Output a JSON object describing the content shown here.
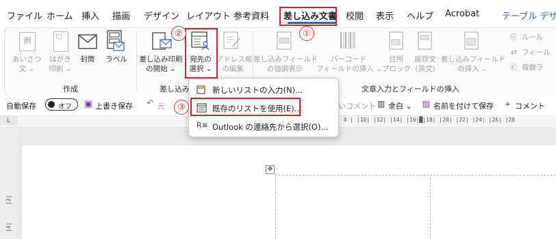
{
  "menu_tabs": [
    {
      "label": "ファイル"
    },
    {
      "label": "ホーム"
    },
    {
      "label": "挿入"
    },
    {
      "label": "描画"
    },
    {
      "label": "デザイン"
    },
    {
      "label": "レイアウト"
    },
    {
      "label": "参考資料"
    },
    {
      "label": "差し込み文書"
    },
    {
      "label": "校閲"
    },
    {
      "label": "表示"
    },
    {
      "label": "ヘルプ"
    },
    {
      "label": "Acrobat"
    },
    {
      "label": "テーブル デザ"
    }
  ],
  "ribbon": {
    "create_group": {
      "label": "作成",
      "greeting": {
        "line1": "あいさつ",
        "line2": "文 ⌄",
        "icon_char": "例"
      },
      "postcard": {
        "line1": "はがき",
        "line2": "印刷 ⌄"
      },
      "envelope": {
        "label": "封筒"
      },
      "label_btn": {
        "label": "ラベル"
      }
    },
    "mailmerge_group": {
      "label": "差し込み",
      "start": {
        "line1": "差し込み印刷",
        "line2": "の開始 ⌄"
      },
      "select_recipients": {
        "line1": "宛先の",
        "line2": "選択 ⌄"
      },
      "edit_list": {
        "line1": "アドレス帳",
        "line2": "の編集"
      }
    },
    "fields_group": {
      "label": "文章入力とフィールドの挿入",
      "highlight": {
        "line1": "差し込みフィールド",
        "line2": "の強調表示"
      },
      "barcode": {
        "line1": "バーコード",
        "line2": "フィールドの挿入 ⌄"
      },
      "address": {
        "line1": "住所",
        "line2": "ブロック"
      },
      "greeting_line": {
        "line1": "挨拶文",
        "line2": "(英文)"
      },
      "insert_field": {
        "line1": "差し込みフィールド",
        "line2": "の挿入 ⌄"
      },
      "rules": {
        "label": "ルール"
      },
      "match_fields": {
        "label": "フィール"
      },
      "update_labels": {
        "label": "複数ラ"
      }
    }
  },
  "qat": {
    "autosave_label": "自動保存",
    "autosave_state": "オフ",
    "save_overwrite": "上書き保存",
    "undo_partial": "元",
    "comment_partial": "いコメント",
    "margins": "余白 ⌄",
    "save_as": "名前を付けて保存",
    "comment_right": "コメント"
  },
  "ruler": {
    "top_marks": "| 8 |  |10|  |12|  |14|  |16|█|18|  |20|  |22|  |24|  |26|  |28",
    "left_marks": [
      "|2|",
      "|4|"
    ]
  },
  "dropdown": {
    "items": [
      {
        "label": "新しいリストの入力(N)..."
      },
      {
        "label": "既存のリストを使用(E)..."
      },
      {
        "label": "Outlook の連絡先から選択(O)..."
      }
    ]
  },
  "annotations": [
    "①",
    "②",
    "③"
  ],
  "colors": {
    "accent_blue": "#2b62c4",
    "annotation_red": "#e01b24"
  }
}
